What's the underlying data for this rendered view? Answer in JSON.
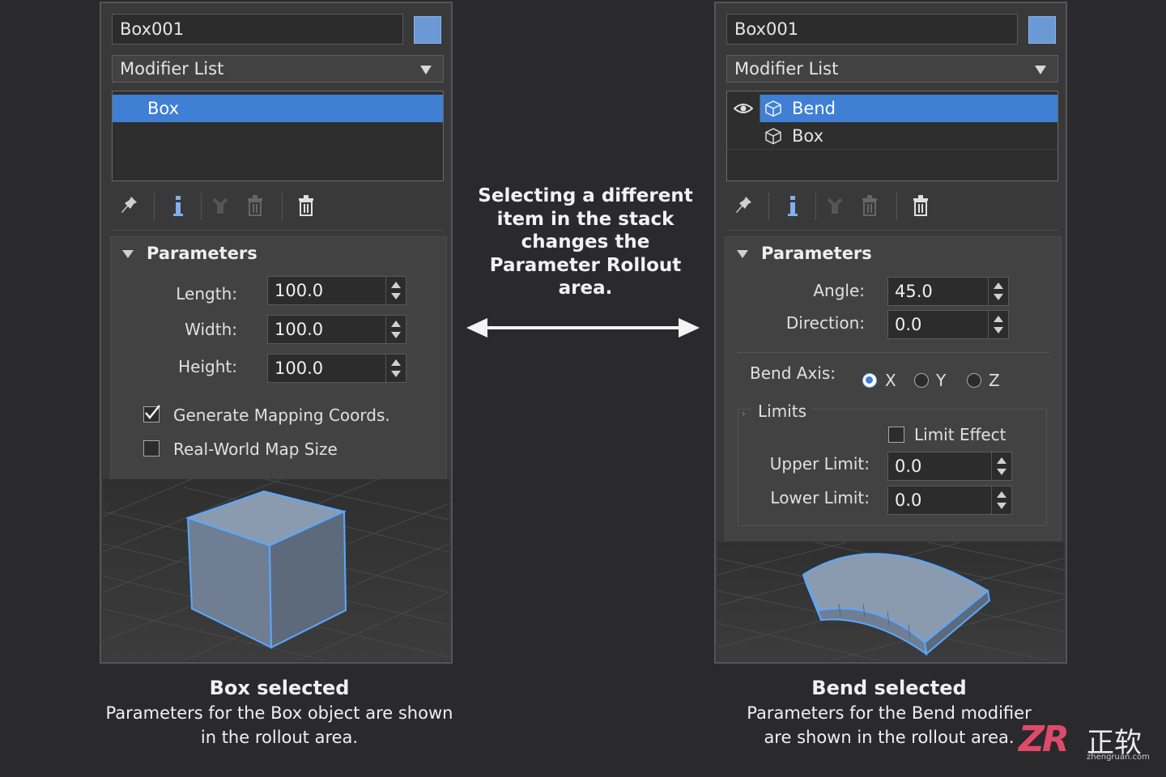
{
  "left_panel": {
    "object_name": "Box001",
    "swatch_color": "#6b99d6",
    "modifier_list": "Modifier List",
    "stack": [
      {
        "label": "Box",
        "selected": true
      }
    ],
    "rollout": {
      "title": "Parameters",
      "fields": [
        {
          "label": "Length:",
          "value": "100.0"
        },
        {
          "label": "Width:",
          "value": "100.0"
        },
        {
          "label": "Height:",
          "value": "100.0"
        }
      ],
      "checkboxes": [
        {
          "label": "Generate Mapping Coords.",
          "checked": true
        },
        {
          "label": "Real-World Map Size",
          "checked": false
        }
      ]
    }
  },
  "right_panel": {
    "object_name": "Box001",
    "swatch_color": "#6b99d6",
    "modifier_list": "Modifier List",
    "stack": [
      {
        "label": "Bend",
        "selected": true
      },
      {
        "label": "Box",
        "selected": false
      }
    ],
    "rollout": {
      "title": "Parameters",
      "fields": [
        {
          "label": "Angle:",
          "value": "45.0"
        },
        {
          "label": "Direction:",
          "value": "0.0"
        }
      ],
      "bend_axis": {
        "label": "Bend Axis:",
        "options": [
          {
            "label": "X",
            "selected": true
          },
          {
            "label": "Y",
            "selected": false
          },
          {
            "label": "Z",
            "selected": false
          }
        ]
      },
      "limits": {
        "title": "Limits",
        "limit_effect": {
          "label": "Limit Effect",
          "checked": false
        },
        "fields": [
          {
            "label": "Upper Limit:",
            "value": "0.0"
          },
          {
            "label": "Lower Limit:",
            "value": "0.0"
          }
        ]
      }
    }
  },
  "center_note": [
    "Selecting a different",
    "item in the stack",
    "changes the",
    "Parameter Rollout",
    "area."
  ],
  "captions": {
    "left": {
      "title": "Box selected",
      "lines": [
        "Parameters for the Box object are shown",
        "in the rollout area."
      ]
    },
    "right": {
      "title": "Bend selected",
      "lines": [
        "Parameters for the Bend modifier",
        "are shown in the rollout area."
      ]
    }
  },
  "watermark": {
    "letters": "ZR",
    "chinese": "正软",
    "url": "zhengruan.com"
  },
  "colors": {
    "selection": "#3f7fd4",
    "accent": "#6b99d6",
    "edge": "#5aa8ff"
  }
}
